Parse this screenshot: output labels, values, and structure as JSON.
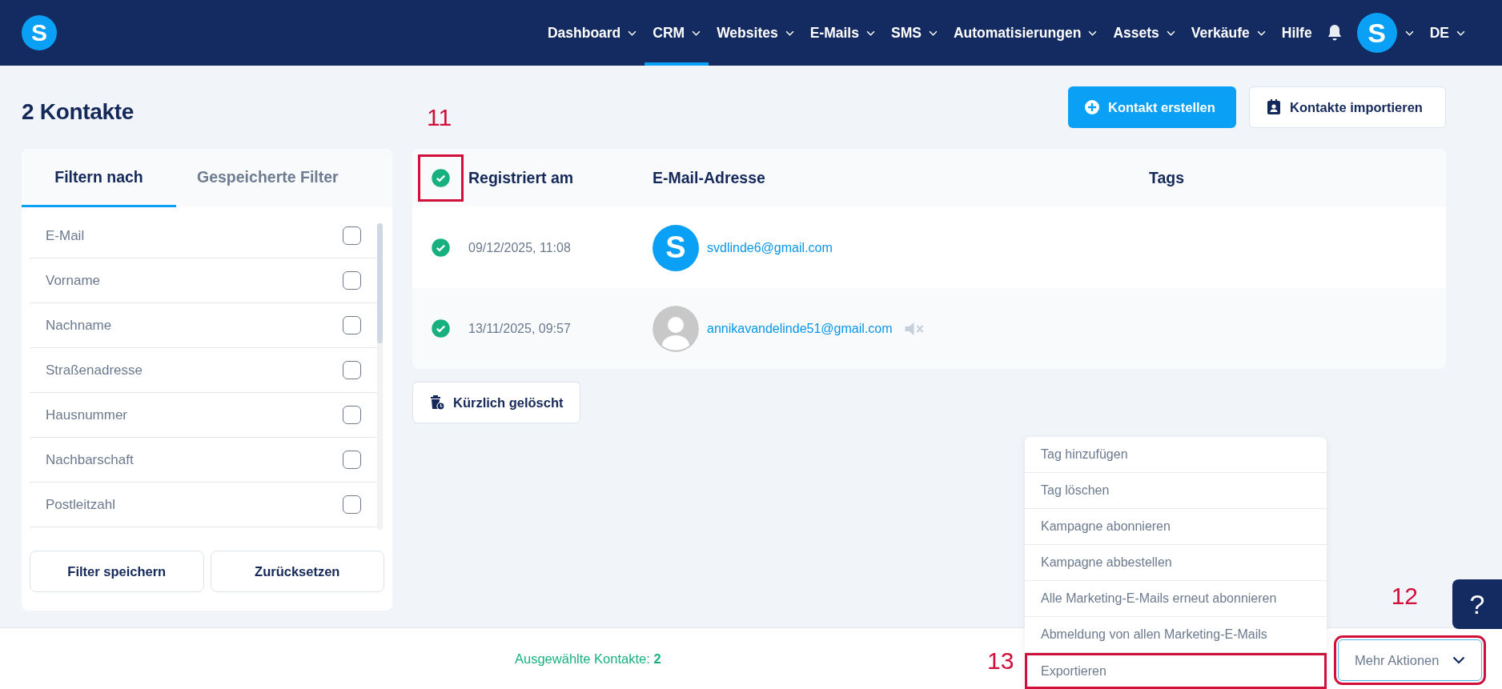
{
  "header": {
    "logo": "S",
    "nav": [
      {
        "label": "Dashboard",
        "dropdown": true,
        "selected": false
      },
      {
        "label": "CRM",
        "dropdown": true,
        "selected": true
      },
      {
        "label": "Websites",
        "dropdown": true,
        "selected": false
      },
      {
        "label": "E-Mails",
        "dropdown": true,
        "selected": false
      },
      {
        "label": "SMS",
        "dropdown": true,
        "selected": false
      },
      {
        "label": "Automatisierungen",
        "dropdown": true,
        "selected": false
      },
      {
        "label": "Assets",
        "dropdown": true,
        "selected": false
      },
      {
        "label": "Verkäufe",
        "dropdown": true,
        "selected": false
      },
      {
        "label": "Hilfe",
        "dropdown": false,
        "selected": false
      }
    ],
    "avatar": "S",
    "language": "DE"
  },
  "title": "2 Kontakte",
  "actions": [
    {
      "label": "Kontakt erstellen",
      "kind": "primary"
    },
    {
      "label": "Kontakte importieren",
      "kind": "secondary"
    }
  ],
  "filter_panel": {
    "tabs": [
      {
        "label": "Filtern nach",
        "selected": true
      },
      {
        "label": "Gespeicherte Filter",
        "selected": false
      }
    ],
    "items": [
      {
        "label": "E-Mail",
        "checked": false
      },
      {
        "label": "Vorname",
        "checked": false
      },
      {
        "label": "Nachname",
        "checked": false
      },
      {
        "label": "Straßenadresse",
        "checked": false
      },
      {
        "label": "Hausnummer",
        "checked": false
      },
      {
        "label": "Nachbarschaft",
        "checked": false
      },
      {
        "label": "Postleitzahl",
        "checked": false
      }
    ],
    "buttons": [
      "Filter speichern",
      "Zurücksetzen"
    ]
  },
  "table": {
    "select_all_checked": true,
    "columns": [
      "Registriert am",
      "E-Mail-Adresse",
      "Tags"
    ],
    "rows": [
      {
        "checked": true,
        "date": "09/12/2025, 11:08",
        "avatar": {
          "kind": "letter",
          "letter": "S"
        },
        "email": "svdlinde6@gmail.com",
        "muted": false
      },
      {
        "checked": true,
        "date": "13/11/2025, 09:57",
        "avatar": {
          "kind": "silhouette"
        },
        "email": "annikavandelinde51@gmail.com",
        "muted": true
      }
    ]
  },
  "recently_deleted": "Kürzlich gelöscht",
  "menu": {
    "items": [
      "Tag hinzufügen",
      "Tag löschen",
      "Kampagne abonnieren",
      "Kampagne abbestellen",
      "Alle Marketing-E-Mails erneut abonnieren",
      "Abmeldung von allen Marketing-E-Mails",
      "Exportieren"
    ]
  },
  "help": "?",
  "footer": {
    "selected_label": "Ausgewählte Kontakte:",
    "selected_count": "2",
    "more_actions": "Mehr Aktionen"
  },
  "annotations": [
    {
      "label": "11"
    },
    {
      "label": "12"
    },
    {
      "label": "13"
    }
  ]
}
